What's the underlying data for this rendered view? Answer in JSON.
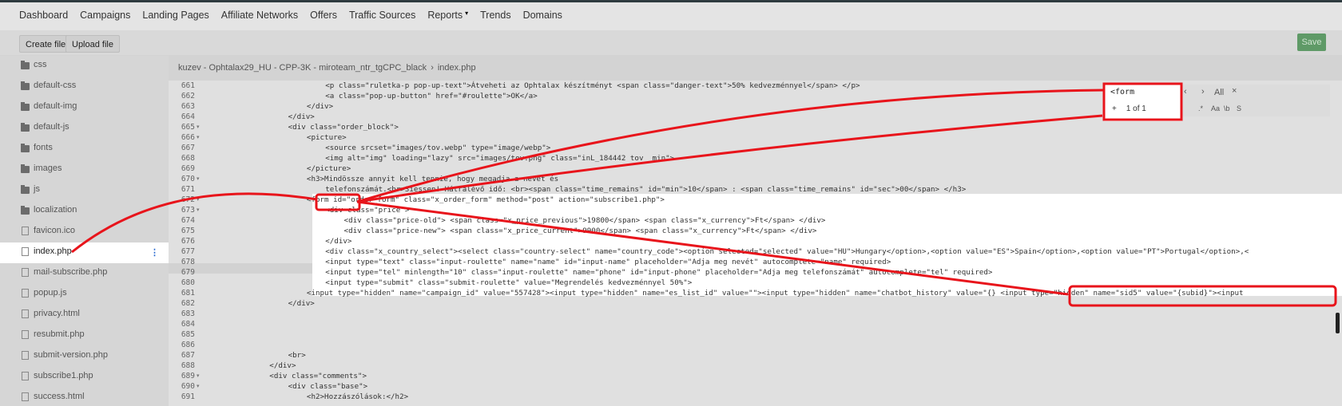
{
  "nav": [
    "Dashboard",
    "Campaigns",
    "Landing Pages",
    "Affiliate Networks",
    "Offers",
    "Traffic Sources",
    "Reports",
    "Trends",
    "Domains"
  ],
  "toolbar": {
    "create": "Create file",
    "upload": "Upload file",
    "save": "Save"
  },
  "breadcrumb": {
    "path": "kuzev - Ophtalax29_HU - CPP-3K - miroteam_ntr_tgCPC_black",
    "file": "index.php"
  },
  "files": [
    {
      "name": "css",
      "type": "folder"
    },
    {
      "name": "default-css",
      "type": "folder"
    },
    {
      "name": "default-img",
      "type": "folder"
    },
    {
      "name": "default-js",
      "type": "folder"
    },
    {
      "name": "fonts",
      "type": "folder"
    },
    {
      "name": "images",
      "type": "folder"
    },
    {
      "name": "js",
      "type": "folder"
    },
    {
      "name": "localization",
      "type": "folder"
    },
    {
      "name": "favicon.ico",
      "type": "file"
    },
    {
      "name": "index.php",
      "type": "file",
      "active": true
    },
    {
      "name": "mail-subscribe.php",
      "type": "file"
    },
    {
      "name": "popup.js",
      "type": "file"
    },
    {
      "name": "privacy.html",
      "type": "file"
    },
    {
      "name": "resubmit.php",
      "type": "file"
    },
    {
      "name": "submit-version.php",
      "type": "file"
    },
    {
      "name": "subscribe1.php",
      "type": "file"
    },
    {
      "name": "success.html",
      "type": "file"
    }
  ],
  "lines": [
    {
      "n": "661",
      "fold": false,
      "indent": 8,
      "text": "<p class=\"ruletka-p pop-up-text\">Átveheti az Ophtalax készítményt <span class=\"danger-text\">50% kedvezménnyel</span> </p>"
    },
    {
      "n": "662",
      "fold": false,
      "indent": 8,
      "text": "<a class=\"pop-up-button\" href=\"#roulette\">OK</a>"
    },
    {
      "n": "663",
      "fold": false,
      "indent": 6,
      "text": "</div>"
    },
    {
      "n": "664",
      "fold": false,
      "indent": 4,
      "text": "</div>"
    },
    {
      "n": "665",
      "fold": true,
      "indent": 4,
      "text": "<div class=\"order_block\">"
    },
    {
      "n": "666",
      "fold": true,
      "indent": 6,
      "text": "<picture>"
    },
    {
      "n": "667",
      "fold": false,
      "indent": 8,
      "text": "<source srcset=\"images/tov.webp\" type=\"image/webp\">"
    },
    {
      "n": "668",
      "fold": false,
      "indent": 8,
      "text": "<img alt=\"img\" loading=\"lazy\" src=\"images/tov.png\" class=\"inL_184442 tov  min\">"
    },
    {
      "n": "669",
      "fold": false,
      "indent": 6,
      "text": "</picture>"
    },
    {
      "n": "670",
      "fold": true,
      "indent": 6,
      "text": "<h3>Mindössze annyit kell tennie, hogy megadja a nevét és"
    },
    {
      "n": "671",
      "fold": false,
      "indent": 8,
      "text": "telefonszámát.<br>Siessen! Hátralévő idő: <br><span class=\"time_remains\" id=\"min\">10</span> : <span class=\"time_remains\" id=\"sec\">00</span> </h3>"
    },
    {
      "n": "672",
      "fold": true,
      "indent": 6,
      "text": "<form id=\"order_form\" class=\"x_order_form\" method=\"post\" action=\"subscribe1.php\">"
    },
    {
      "n": "673",
      "fold": true,
      "indent": 8,
      "text": "<div class=\"price\">"
    },
    {
      "n": "674",
      "fold": false,
      "indent": 10,
      "text": "<div class=\"price-old\"> <span class=\"x_price_previous\">19800</span> <span class=\"x_currency\">Ft</span> </div>"
    },
    {
      "n": "675",
      "fold": false,
      "indent": 10,
      "text": "<div class=\"price-new\"> <span class=\"x_price_current\">9900</span> <span class=\"x_currency\">Ft</span> </div>"
    },
    {
      "n": "676",
      "fold": false,
      "indent": 8,
      "text": "</div>"
    },
    {
      "n": "677",
      "fold": false,
      "indent": 8,
      "text": "<div class=\"x_country_select\"><select class=\"country-select\" name=\"country_code\"><option selected=\"selected\" value=\"HU\">Hungary</option>,<option value=\"ES\">Spain</option>,<option value=\"PT\">Portugal</option>,<"
    },
    {
      "n": "678",
      "fold": false,
      "indent": 8,
      "text": "<input type=\"text\" class=\"input-roulette\" name=\"name\" id=\"input-name\" placeholder=\"Adja meg nevét\" autocomplete=\"name\" required>"
    },
    {
      "n": "679",
      "fold": false,
      "indent": 8,
      "text": "<input type=\"tel\" minlength=\"10\" class=\"input-roulette\" name=\"phone\" id=\"input-phone\" placeholder=\"Adja meg telefonszámát\" autocomplete=\"tel\" required>"
    },
    {
      "n": "680",
      "fold": false,
      "indent": 8,
      "text": "<input type=\"submit\" class=\"submit-roulette\" value=\"Megrendelés kedvezménnyel 50%\">"
    },
    {
      "n": "681",
      "fold": false,
      "indent": 6,
      "text": "<input type=\"hidden\" name=\"campaign_id\" value=\"557428\"><input type=\"hidden\" name=\"es_list_id\" value=\"\"><input type=\"hidden\" name=\"chatbot_history\" value=\"{} <input type=\"hidden\" name=\"sid5\" value=\"{subid}\"><input"
    },
    {
      "n": "682",
      "fold": false,
      "indent": 4,
      "text": "</div>"
    },
    {
      "n": "683",
      "fold": false,
      "indent": 0,
      "text": ""
    },
    {
      "n": "684",
      "fold": false,
      "indent": 0,
      "text": ""
    },
    {
      "n": "685",
      "fold": false,
      "indent": 0,
      "text": ""
    },
    {
      "n": "686",
      "fold": false,
      "indent": 0,
      "text": ""
    },
    {
      "n": "687",
      "fold": false,
      "indent": 4,
      "text": "<br>"
    },
    {
      "n": "688",
      "fold": false,
      "indent": 2,
      "text": "</div>"
    },
    {
      "n": "689",
      "fold": true,
      "indent": 2,
      "text": "<div class=\"comments\">"
    },
    {
      "n": "690",
      "fold": true,
      "indent": 4,
      "text": "<div class=\"base\">"
    },
    {
      "n": "691",
      "fold": false,
      "indent": 6,
      "text": "<h2>Hozzászólások:</h2>"
    }
  ],
  "search": {
    "query": "<form",
    "count": "1 of 1",
    "all": "All",
    "close": "×",
    "plus": "+",
    "regex": ".*",
    "case": "Aa",
    "word": "\\b",
    "s": "S"
  },
  "annotation_color": "#e8141b"
}
